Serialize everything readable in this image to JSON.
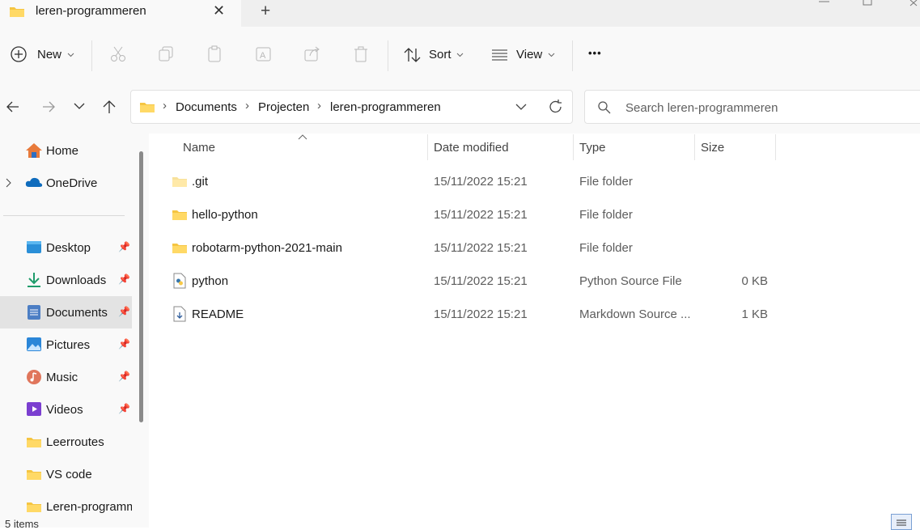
{
  "tab": {
    "title": "leren-programmeren",
    "close": "✕",
    "new": "+"
  },
  "toolbar": {
    "new_label": "New",
    "sort_label": "Sort",
    "view_label": "View",
    "more": "•••"
  },
  "address": {
    "crumbs": [
      "Documents",
      "Projecten",
      "leren-programmeren"
    ],
    "search_placeholder": "Search leren-programmeren"
  },
  "sidebar": {
    "items": [
      {
        "label": "Home",
        "icon": "home-icon"
      },
      {
        "label": "OneDrive",
        "icon": "onedrive-icon"
      },
      {
        "label": "Desktop",
        "icon": "desktop-icon"
      },
      {
        "label": "Downloads",
        "icon": "downloads-icon"
      },
      {
        "label": "Documents",
        "icon": "documents-icon"
      },
      {
        "label": "Pictures",
        "icon": "pictures-icon"
      },
      {
        "label": "Music",
        "icon": "music-icon"
      },
      {
        "label": "Videos",
        "icon": "videos-icon"
      },
      {
        "label": "Leerroutes",
        "icon": "folder-icon"
      },
      {
        "label": "VS code",
        "icon": "folder-icon"
      },
      {
        "label": "Leren-programmeren",
        "icon": "folder-icon"
      }
    ]
  },
  "columns": {
    "name": "Name",
    "date": "Date modified",
    "type": "Type",
    "size": "Size"
  },
  "files": [
    {
      "name": ".git",
      "date": "15/11/2022 15:21",
      "type": "File folder",
      "size": ""
    },
    {
      "name": "hello-python",
      "date": "15/11/2022 15:21",
      "type": "File folder",
      "size": ""
    },
    {
      "name": "robotarm-python-2021-main",
      "date": "15/11/2022 15:21",
      "type": "File folder",
      "size": ""
    },
    {
      "name": "python",
      "date": "15/11/2022 15:21",
      "type": "Python Source File",
      "size": "0 KB"
    },
    {
      "name": "README",
      "date": "15/11/2022 15:21",
      "type": "Markdown Source ...",
      "size": "1 KB"
    }
  ],
  "status": {
    "count": "5 items"
  },
  "colors": {
    "folder": "#f5c542",
    "selection": "#e3e3e3",
    "accent": "#0067c0"
  }
}
